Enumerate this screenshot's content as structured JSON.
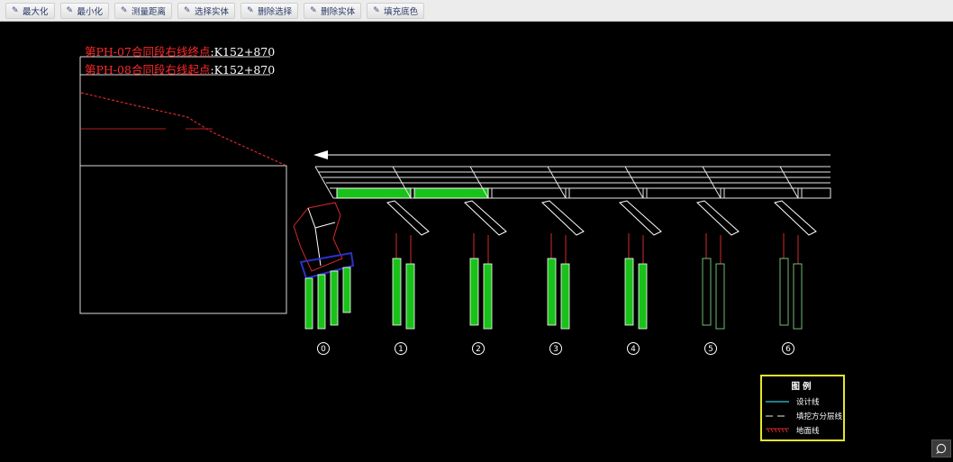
{
  "toolbar": {
    "buttons": [
      {
        "label": "最大化",
        "icon": "pen-icon"
      },
      {
        "label": "最小化",
        "icon": "pen-icon"
      },
      {
        "label": "测量距离",
        "icon": "pen-icon"
      },
      {
        "label": "选择实体",
        "icon": "pen-icon"
      },
      {
        "label": "删除选择",
        "icon": "pen-icon"
      },
      {
        "label": "删除实体",
        "icon": "pen-icon"
      },
      {
        "label": "填充底色",
        "icon": "pen-icon"
      }
    ]
  },
  "annotations": {
    "line1_red": "第PH-07合同段右线终点",
    "line1_white": ":K152+870",
    "line2_red": "第PH-08合同段右线起点",
    "line2_white": ":K152+870"
  },
  "piers": [
    "0",
    "1",
    "2",
    "3",
    "4",
    "5",
    "6"
  ],
  "legend": {
    "title": "图例",
    "items": [
      {
        "label": "设计线",
        "color": "#39c6d6"
      },
      {
        "label": "填挖方分层线",
        "color": "#bbbbbb"
      },
      {
        "label": "地面线",
        "color": "#d42a2a"
      }
    ]
  },
  "colors": {
    "background": "#000000",
    "pile_fill": "#19c219",
    "deck_outline": "#ffffff",
    "legend_border": "#e6e62a",
    "ground_line": "#d42a2a"
  }
}
